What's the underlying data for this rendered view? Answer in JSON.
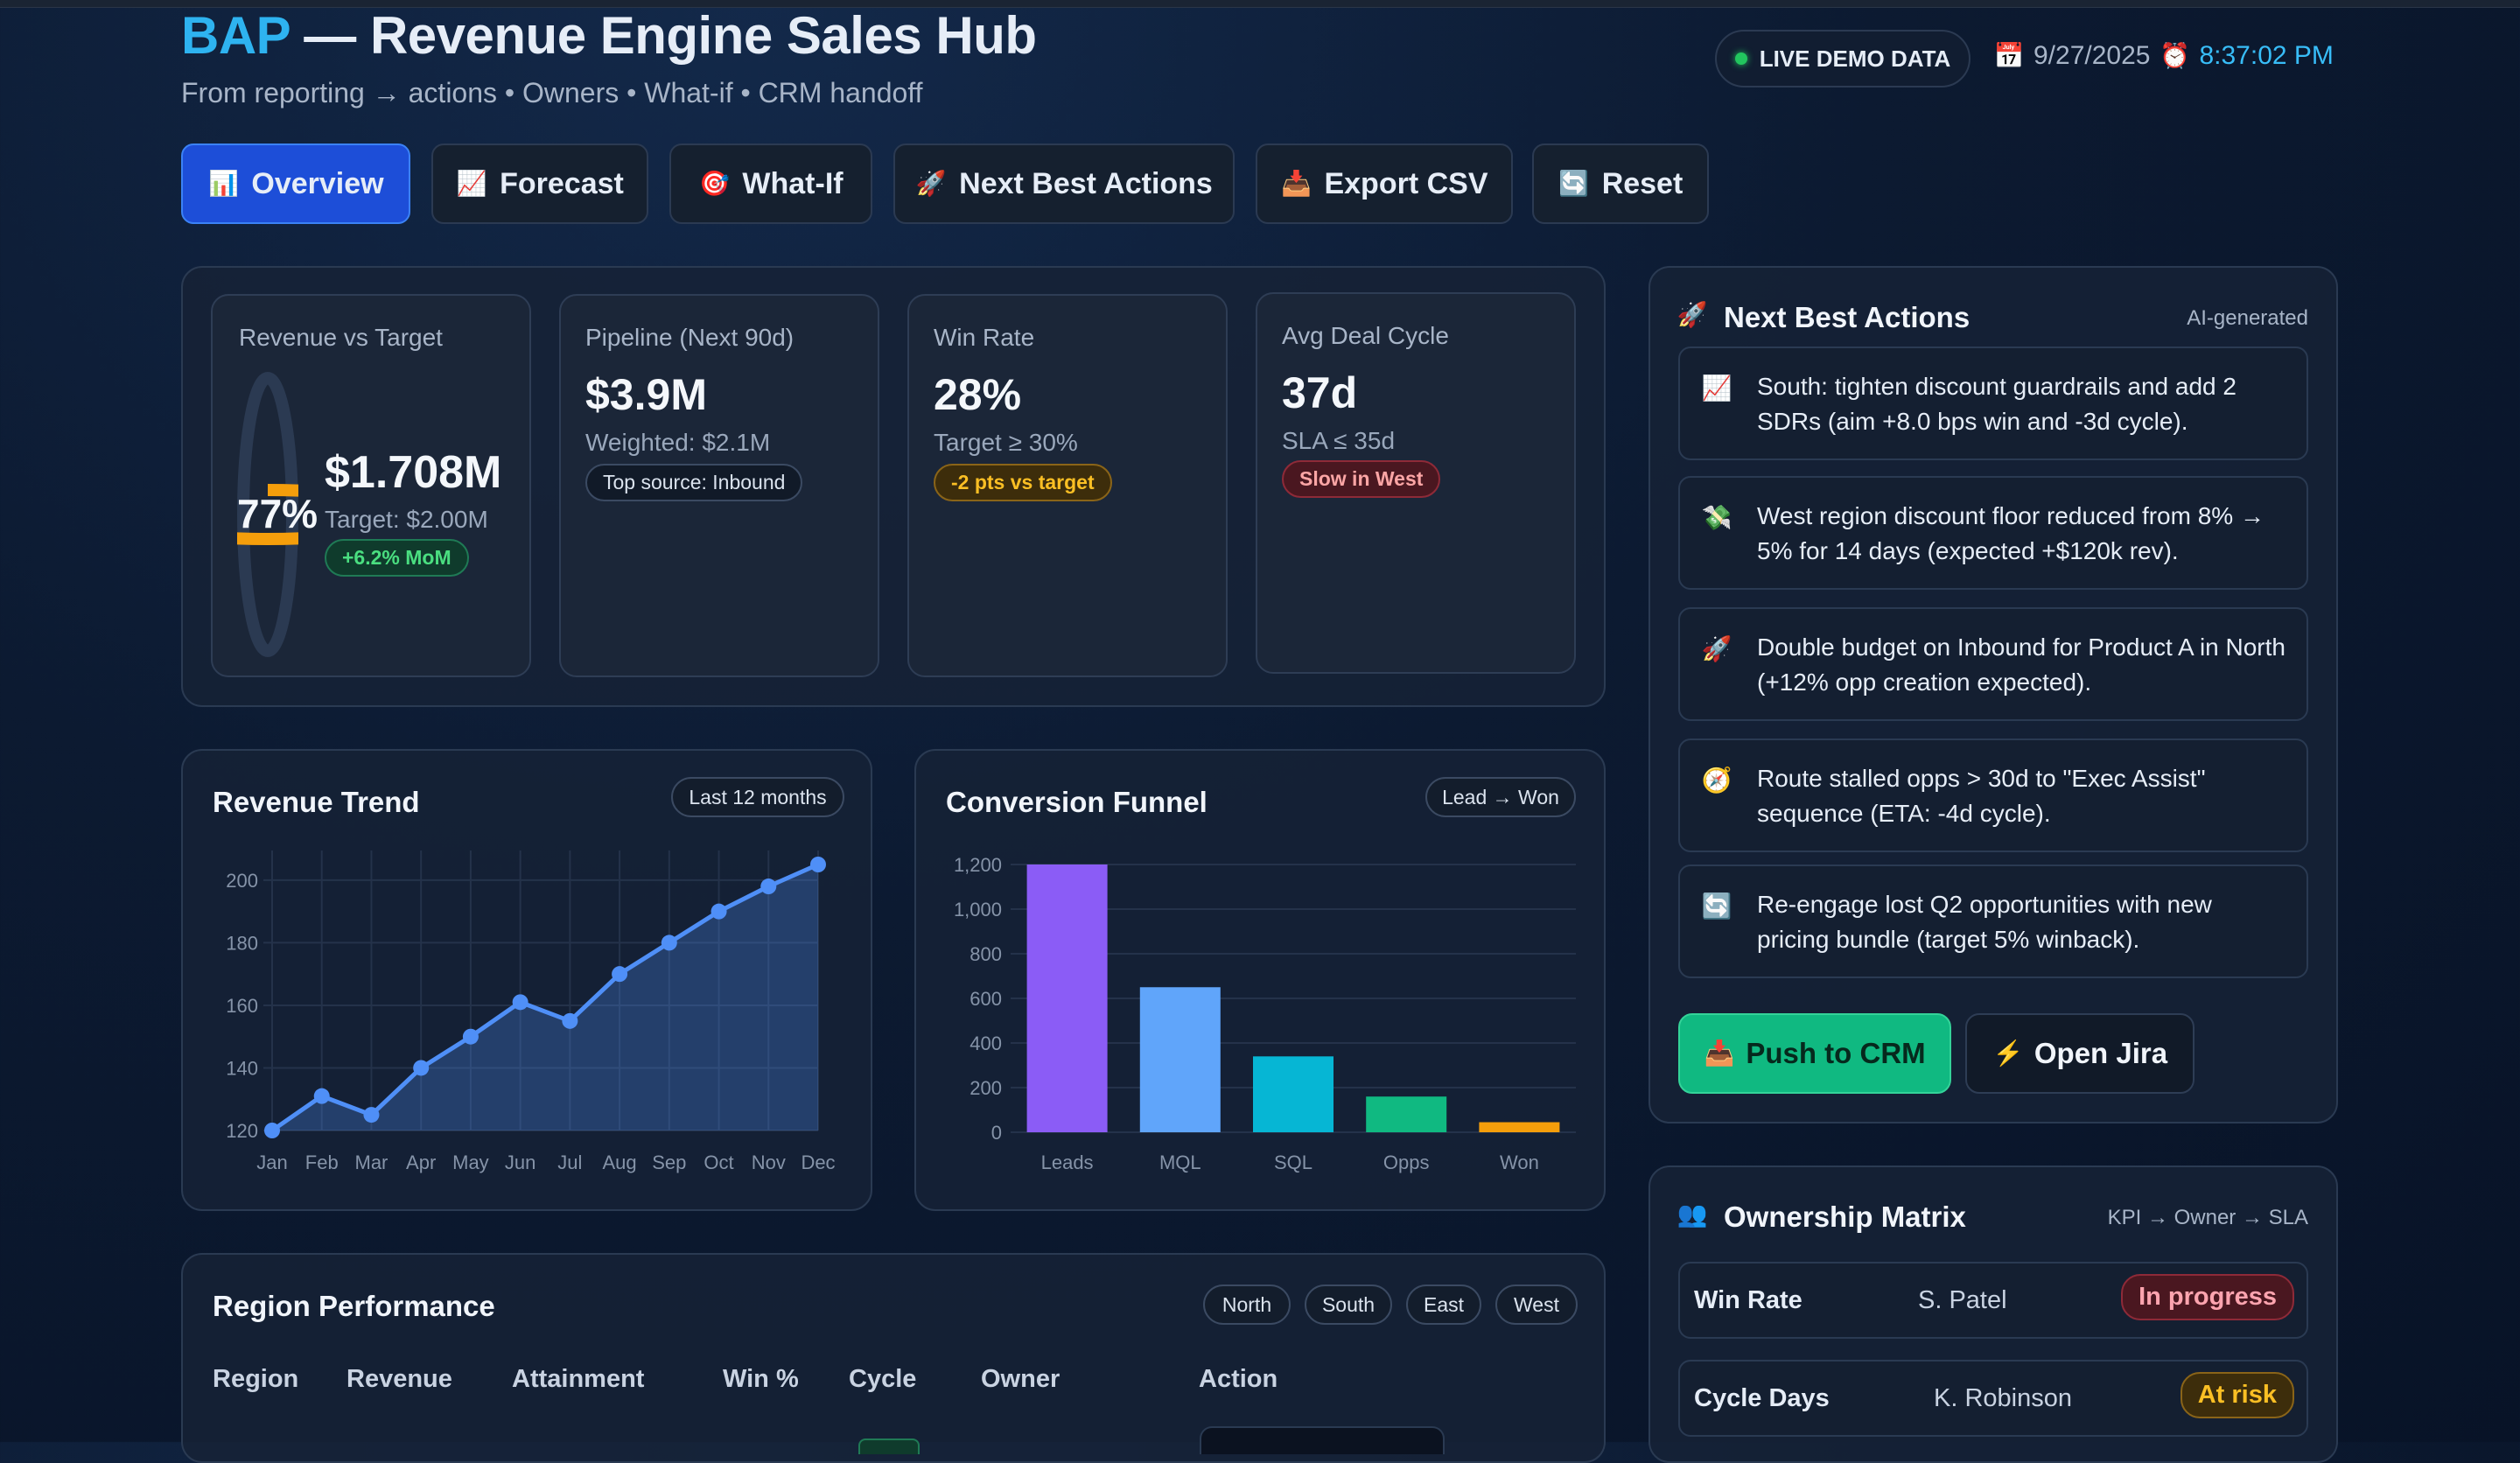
{
  "header": {
    "brand": "BAP",
    "title_rest": " — Revenue Engine Sales Hub",
    "subtitle": "From reporting → actions • Owners • What-if • CRM handoff",
    "live_label": "LIVE DEMO DATA",
    "date": "9/27/2025",
    "time": "8:37:02 PM"
  },
  "tabs": [
    {
      "icon": "📊",
      "label": "Overview"
    },
    {
      "icon": "📈",
      "label": "Forecast"
    },
    {
      "icon": "🎯",
      "label": "What-If"
    },
    {
      "icon": "🚀",
      "label": "Next Best Actions"
    },
    {
      "icon": "📥",
      "label": "Export CSV"
    },
    {
      "icon": "🔄",
      "label": "Reset"
    }
  ],
  "kpis": {
    "revenue": {
      "label": "Revenue vs Target",
      "percent": 77,
      "percent_label": "77%",
      "value": "$1.708M",
      "sub": "Target: $2.00M",
      "badge": "+6.2% MoM"
    },
    "pipeline": {
      "label": "Pipeline (Next 90d)",
      "value": "$3.9M",
      "sub": "Weighted: $2.1M",
      "badge": "Top source: Inbound"
    },
    "winrate": {
      "label": "Win Rate",
      "value": "28%",
      "sub": "Target ≥ 30%",
      "badge": "-2 pts vs target"
    },
    "cycle": {
      "label": "Avg Deal Cycle",
      "value": "37d",
      "sub": "SLA ≤ 35d",
      "badge": "Slow in West"
    }
  },
  "revenue_trend": {
    "title": "Revenue Trend",
    "chip": "Last 12 months"
  },
  "funnel": {
    "title": "Conversion Funnel",
    "chip": "Lead → Won"
  },
  "chart_data": [
    {
      "type": "area",
      "categories": [
        "Jan",
        "Feb",
        "Mar",
        "Apr",
        "May",
        "Jun",
        "Jul",
        "Aug",
        "Sep",
        "Oct",
        "Nov",
        "Dec"
      ],
      "values": [
        120,
        131,
        125,
        140,
        150,
        161,
        155,
        170,
        180,
        190,
        198,
        205
      ],
      "yticks": [
        120,
        140,
        160,
        180,
        200
      ],
      "ylim": [
        120,
        205
      ],
      "grid": true,
      "color": "#4f8ff7"
    },
    {
      "type": "bar",
      "categories": [
        "Leads",
        "MQL",
        "SQL",
        "Opps",
        "Won"
      ],
      "values": [
        1200,
        650,
        340,
        160,
        45
      ],
      "yticks": [
        0,
        200,
        400,
        600,
        800,
        1000,
        1200
      ],
      "ytick_labels": [
        "0",
        "200",
        "400",
        "600",
        "800",
        "1,000",
        "1,200"
      ],
      "ylim": [
        0,
        1200
      ],
      "grid": true,
      "colors": [
        "#8b5cf6",
        "#60a5fa",
        "#06b6d4",
        "#10b981",
        "#f59e0b"
      ]
    }
  ],
  "next_best_actions": {
    "title": "Next Best Actions",
    "tag": "AI-generated",
    "items": [
      {
        "icon": "📈",
        "text": "South: tighten discount guardrails and add 2 SDRs (aim +8.0 bps win and -3d cycle)."
      },
      {
        "icon": "💸",
        "text": "West region discount floor reduced from 8% → 5% for 14 days (expected +$120k rev)."
      },
      {
        "icon": "🚀",
        "text": "Double budget on Inbound for Product A in North (+12% opp creation expected)."
      },
      {
        "icon": "🧭",
        "text": "Route stalled opps > 30d to \"Exec Assist\" sequence (ETA: -4d cycle)."
      },
      {
        "icon": "🔄",
        "text": "Re-engage lost Q2 opportunities with new pricing bundle (target 5% winback)."
      }
    ],
    "push_label": "Push to CRM",
    "jira_label": "Open Jira"
  },
  "ownership": {
    "title": "Ownership Matrix",
    "tag": "KPI → Owner → SLA",
    "rows": [
      {
        "kpi": "Win Rate",
        "owner": "S. Patel",
        "status": "In progress"
      },
      {
        "kpi": "Cycle Days",
        "owner": "K. Robinson",
        "status": "At risk"
      }
    ]
  },
  "region": {
    "title": "Region Performance",
    "chips": [
      "North",
      "South",
      "East",
      "West"
    ],
    "headers": [
      "Region",
      "Revenue",
      "Attainment",
      "Win %",
      "Cycle",
      "Owner",
      "Action"
    ]
  },
  "colors": {
    "accent": "#2eb3f0",
    "primary": "#1d4ed8",
    "success": "#10b981",
    "warning": "#fbbf24",
    "danger": "#fca5a5"
  }
}
